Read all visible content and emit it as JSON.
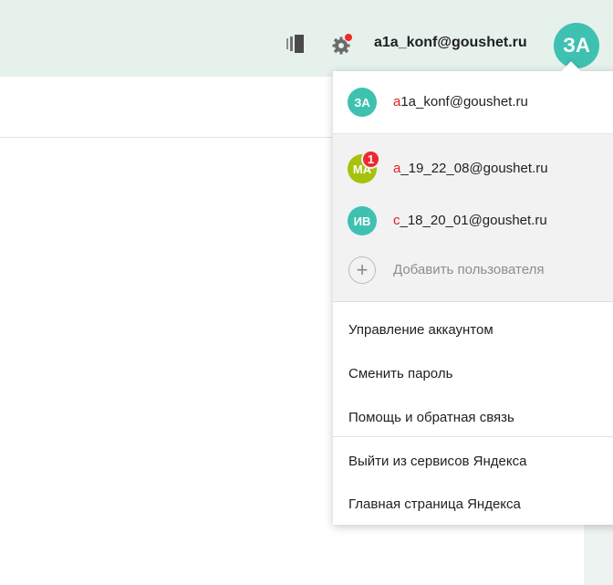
{
  "header": {
    "icons": [
      "panels-icon",
      "gear-icon"
    ],
    "login": "a1a_konf@goushet.ru",
    "avatar_initials": "ЗА",
    "avatar_color": "#3ec1b1"
  },
  "popup": {
    "current_account": {
      "initials": "ЗА",
      "first_char": "a",
      "rest": "1a_konf@goushet.ru",
      "color": "#3ec1b1"
    },
    "other_accounts": [
      {
        "initials": "МА",
        "first_char": "a",
        "rest": "_19_22_08@goushet.ru",
        "color": "#a6c20a",
        "badge": "1"
      },
      {
        "initials": "ИВ",
        "first_char": "c",
        "rest": "_18_20_01@goushet.ru",
        "color": "#3ec1b1"
      }
    ],
    "add_user_label": "Добавить пользователя",
    "menu_items": [
      "Управление аккаунтом",
      "Сменить пароль",
      "Помощь и обратная связь"
    ],
    "bottom_items": [
      "Выйти из сервисов Яндекса",
      "Главная страница Яндекса"
    ]
  },
  "colors": {
    "header_bg": "#e6f1ec",
    "accent_red": "#e0202a"
  }
}
